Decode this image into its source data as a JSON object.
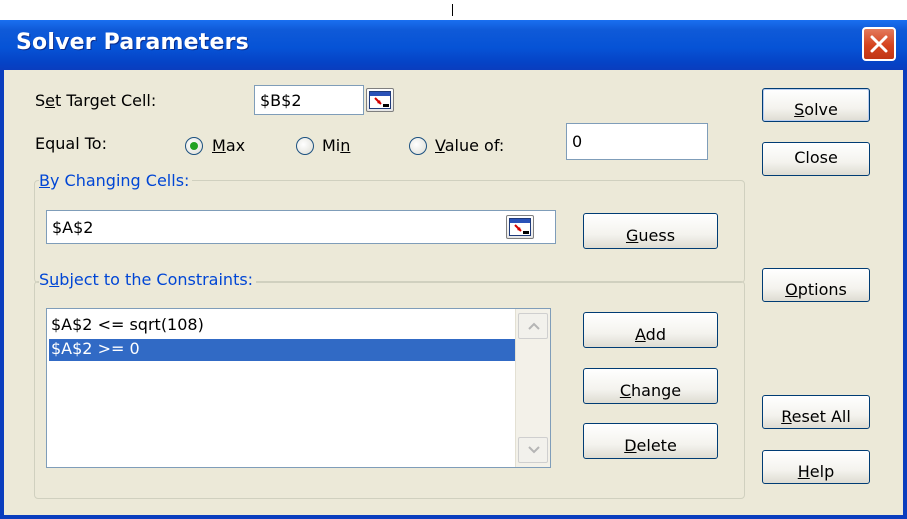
{
  "dialog": {
    "title": "Solver Parameters"
  },
  "target": {
    "label_pre": "S",
    "label_u": "e",
    "label_post": "t Target Cell:",
    "value": "$B$2"
  },
  "equal_to": {
    "label": "Equal To:",
    "max_label_u": "M",
    "max_label_post": "ax",
    "min_label_pre": "Mi",
    "min_label_u": "n",
    "value_label_u": "V",
    "value_label_post": "alue of:",
    "value_field": "0",
    "selected": "max"
  },
  "changing": {
    "group_title_u": "B",
    "group_title_post": "y Changing Cells:",
    "value": "$A$2",
    "guess_u": "G",
    "guess_post": "uess"
  },
  "constraints": {
    "group_title_pre": "S",
    "group_title_u": "u",
    "group_title_post": "bject to the Constraints:",
    "items": [
      "$A$2 <= sqrt(108)",
      "$A$2 >= 0"
    ],
    "selected_index": 1,
    "add_u": "A",
    "add_post": "dd",
    "change_u": "C",
    "change_post": "hange",
    "delete_u": "D",
    "delete_post": "elete"
  },
  "side_buttons": {
    "solve_u": "S",
    "solve_post": "olve",
    "close": "Close",
    "options_u": "O",
    "options_post": "ptions",
    "reset_u": "R",
    "reset_post": "eset All",
    "help_u": "H",
    "help_post": "elp"
  },
  "colors": {
    "titlebar": "#0653d6",
    "dialog_bg": "#ece9d8",
    "group_title": "#0046d5",
    "selection": "#316ac5",
    "close_button": "#d5431f"
  },
  "icons": [
    "collapse-dialog-icon",
    "close-icon",
    "scroll-up-icon",
    "scroll-down-icon"
  ]
}
